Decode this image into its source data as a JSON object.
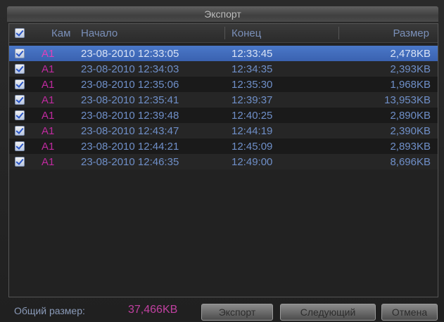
{
  "dialog": {
    "title": "Экспорт"
  },
  "columns": {
    "cam": "Кам",
    "start": "Начало",
    "end": "Конец",
    "size": "Размер"
  },
  "rows": [
    {
      "cam": "A1",
      "start": "23-08-2010 12:33:05",
      "end": "12:33:45",
      "size": "2,478KB",
      "selected": true
    },
    {
      "cam": "A1",
      "start": "23-08-2010 12:34:03",
      "end": "12:34:35",
      "size": "2,393KB"
    },
    {
      "cam": "A1",
      "start": "23-08-2010 12:35:06",
      "end": "12:35:30",
      "size": "1,968KB"
    },
    {
      "cam": "A1",
      "start": "23-08-2010 12:35:41",
      "end": "12:39:37",
      "size": "13,953KB"
    },
    {
      "cam": "A1",
      "start": "23-08-2010 12:39:48",
      "end": "12:40:25",
      "size": "2,890KB"
    },
    {
      "cam": "A1",
      "start": "23-08-2010 12:43:47",
      "end": "12:44:19",
      "size": "2,390KB"
    },
    {
      "cam": "A1",
      "start": "23-08-2010 12:44:21",
      "end": "12:45:09",
      "size": "2,893KB"
    },
    {
      "cam": "A1",
      "start": "23-08-2010 12:46:35",
      "end": "12:49:00",
      "size": "8,696KB"
    }
  ],
  "footer": {
    "total_label": "Общий размер:",
    "total_value": "37,466KB",
    "buttons": {
      "export": "Экспорт",
      "next": "Следующий",
      "cancel": "Отмена"
    }
  }
}
